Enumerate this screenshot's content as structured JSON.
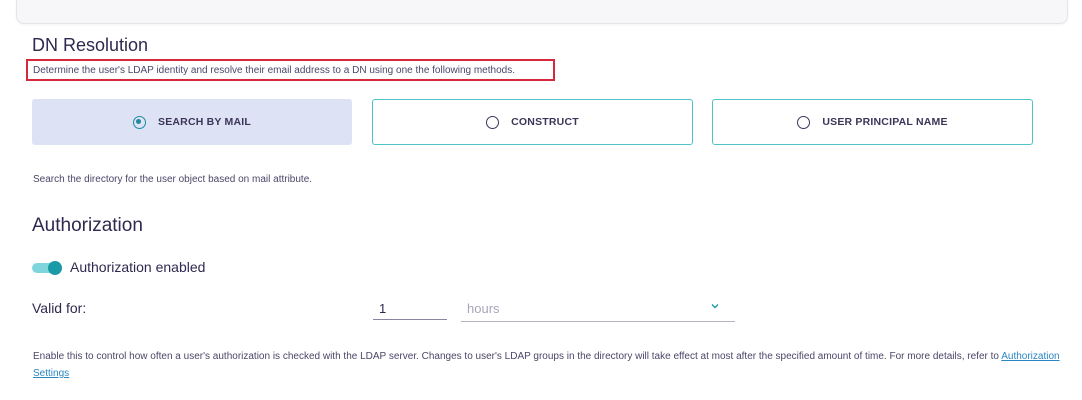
{
  "dn_resolution": {
    "title": "DN Resolution",
    "description": "Determine the user's LDAP identity and resolve their email address to a DN using one the following methods.",
    "options": [
      {
        "label": "SEARCH BY MAIL",
        "selected": true
      },
      {
        "label": "CONSTRUCT",
        "selected": false
      },
      {
        "label": "USER PRINCIPAL NAME",
        "selected": false
      }
    ],
    "selected_description": "Search the directory for the user object based on mail attribute."
  },
  "authorization": {
    "title": "Authorization",
    "toggle_label": "Authorization enabled",
    "toggle_on": true,
    "valid_for_label": "Valid for:",
    "valid_for_value": "1",
    "unit_value": "hours",
    "help_text": "Enable this to control how often a user's authorization is checked with the LDAP server. Changes to user's LDAP groups in the directory will take effect at most after the specified amount of time. For more details, refer to",
    "help_link": "Authorization Settings"
  },
  "colors": {
    "accent": "#1a9aa6",
    "selected_bg": "#dde3f5",
    "option_border": "#4dc3c8",
    "highlight_box": "#d62a3c"
  },
  "icons": {
    "radio": "radio-icon",
    "chevron": "chevron-down-icon"
  }
}
